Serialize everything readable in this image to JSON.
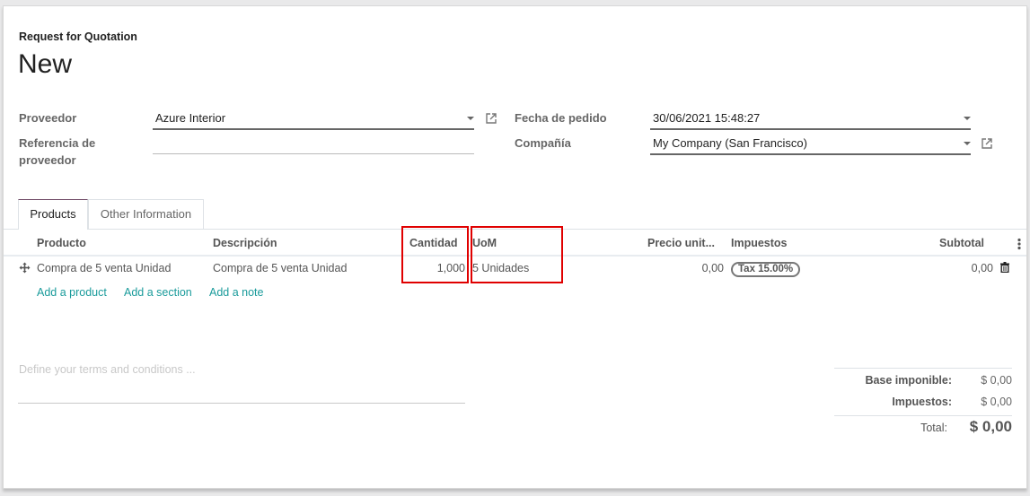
{
  "header": {
    "subtitle": "Request for Quotation",
    "title": "New"
  },
  "form": {
    "vendor_label": "Proveedor",
    "vendor_value": "Azure Interior",
    "vendor_ref_label_1": "Referencia de",
    "vendor_ref_label_2": "proveedor",
    "vendor_ref_value": "",
    "order_date_label": "Fecha de pedido",
    "order_date_value": "30/06/2021 15:48:27",
    "company_label": "Compañía",
    "company_value": "My Company (San Francisco)"
  },
  "tabs": [
    {
      "label": "Products",
      "active": true
    },
    {
      "label": "Other Information",
      "active": false
    }
  ],
  "table": {
    "columns": [
      "Producto",
      "Descripción",
      "Cantidad",
      "UoM",
      "Precio unit...",
      "Impuestos",
      "Subtotal"
    ],
    "rows": [
      {
        "product": "Compra de 5 venta Unidad",
        "description": "Compra de 5 venta Unidad",
        "quantity": "1,000",
        "uom": "5 Unidades",
        "unit_price": "0,00",
        "tax": "Tax 15.00%",
        "subtotal": "0,00"
      }
    ],
    "actions": [
      "Add a product",
      "Add a section",
      "Add a note"
    ]
  },
  "notes": {
    "placeholder": "Define your terms and conditions ..."
  },
  "totals": {
    "base_label": "Base imponible:",
    "base_value": "$ 0,00",
    "taxes_label": "Impuestos:",
    "taxes_value": "$ 0,00",
    "total_label": "Total:",
    "total_value": "$ 0,00"
  },
  "colors": {
    "accent": "#714b67",
    "link": "#1a9b9b",
    "highlight": "#e00000"
  }
}
